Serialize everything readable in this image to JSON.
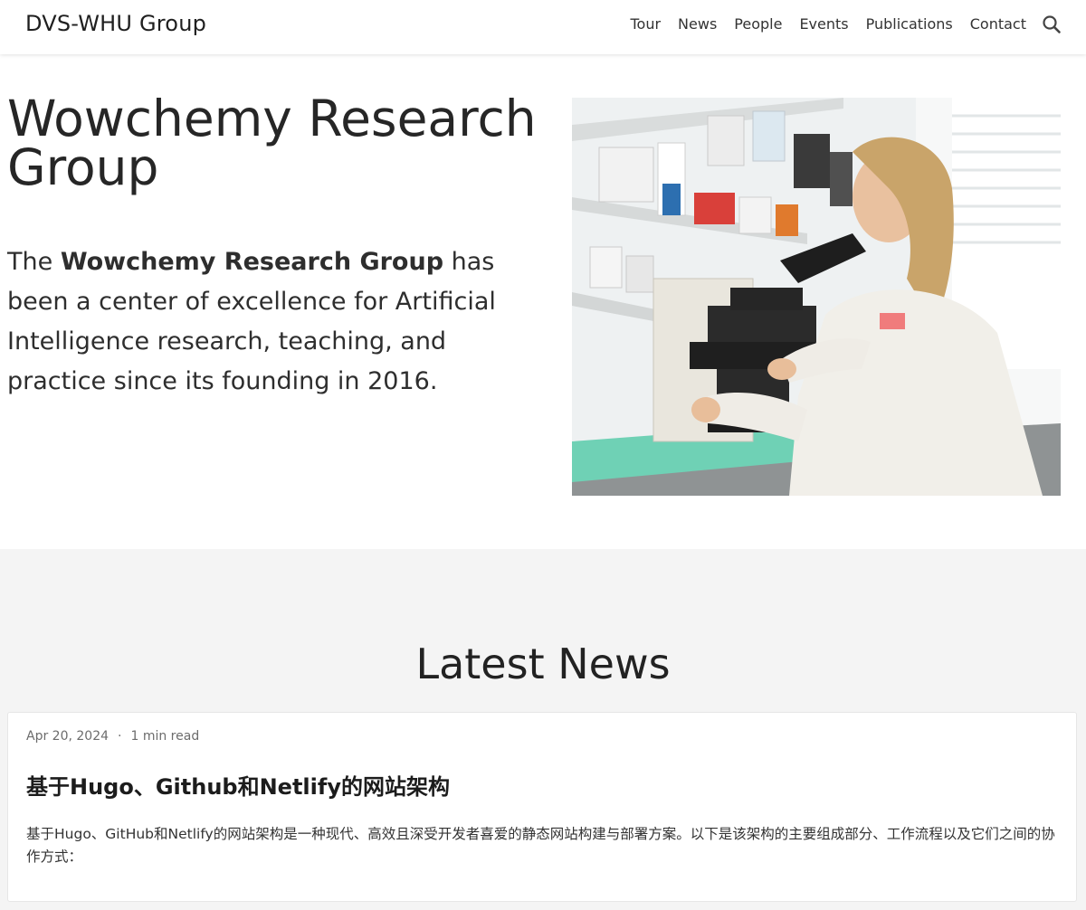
{
  "navbar": {
    "brand": "DVS-WHU Group",
    "items": [
      {
        "label": "Tour"
      },
      {
        "label": "News"
      },
      {
        "label": "People"
      },
      {
        "label": "Events"
      },
      {
        "label": "Publications"
      },
      {
        "label": "Contact"
      }
    ],
    "search_icon": "search-icon"
  },
  "hero": {
    "title": "Wowchemy Research Group",
    "text_before": "The ",
    "text_bold": "Wowchemy Research Group",
    "text_after": " has been a center of excellence for Artificial Intelligence research, teaching, and practice since its founding in 2016.",
    "image_icon": "lab-scientist-microscope-photo"
  },
  "news": {
    "heading": "Latest News",
    "post": {
      "date": "Apr 20, 2024",
      "separator": "·",
      "read_time": "1 min read",
      "title": "基于Hugo、Github和Netlify的网站架构",
      "summary": "基于Hugo、GitHub和Netlify的网站架构是一种现代、高效且深受开发者喜爱的静态网站构建与部署方案。以下是该架构的主要组成部分、工作流程以及它们之间的协作方式："
    }
  },
  "colors": {
    "nav_bg": "#ffffff",
    "section_bg": "#f4f4f4",
    "text": "#2b2b2b"
  }
}
